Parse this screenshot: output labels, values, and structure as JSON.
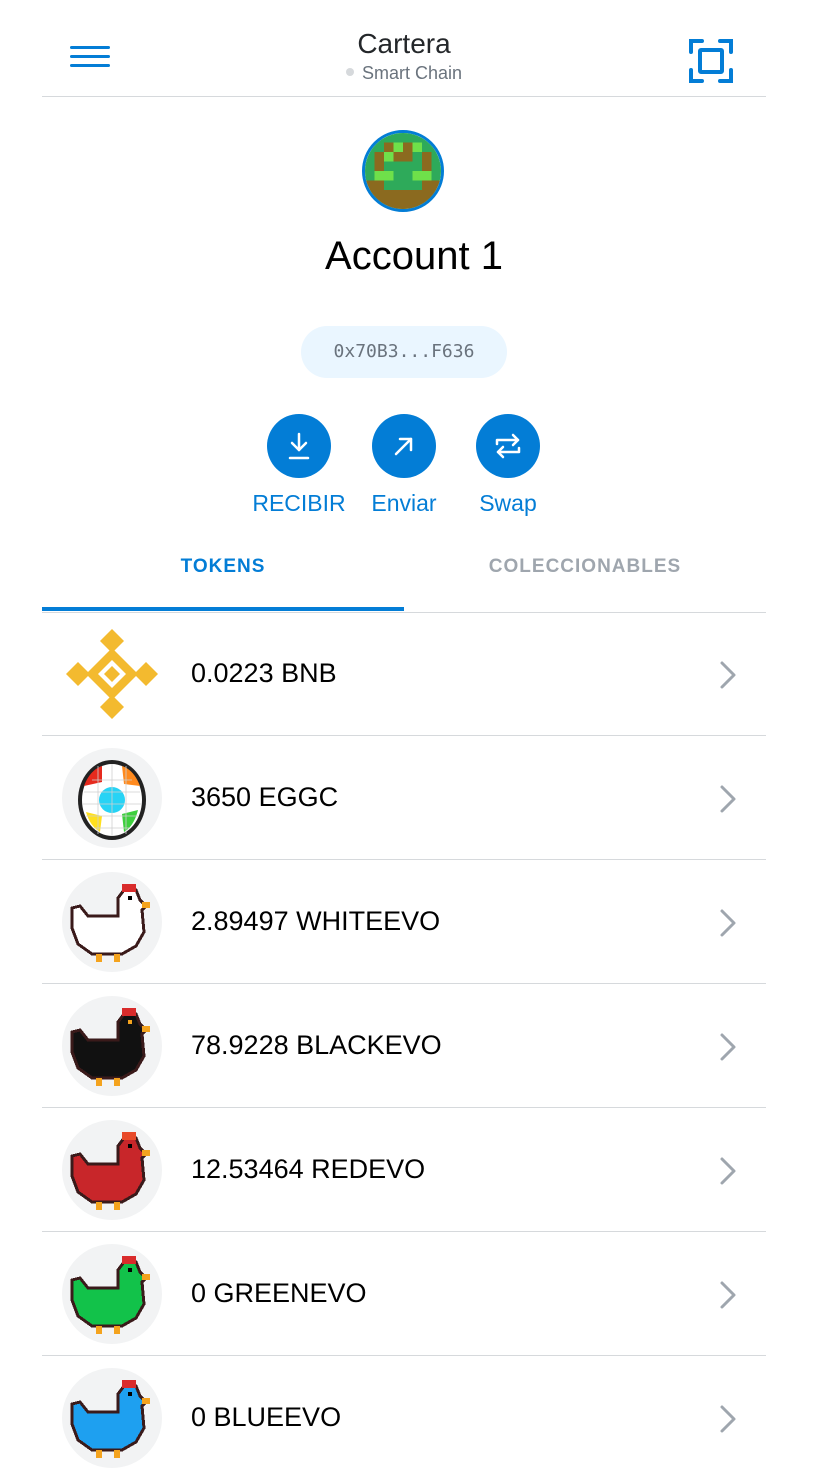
{
  "header": {
    "title": "Cartera",
    "network": "Smart Chain",
    "menu_icon": "hamburger-icon",
    "scan_icon": "qr-scan-icon",
    "accent_color": "#037dd6"
  },
  "account": {
    "name": "Account 1",
    "address": "0x70B3...F636"
  },
  "actions": [
    {
      "label": "RECIBIR",
      "icon": "download-icon"
    },
    {
      "label": "Enviar",
      "icon": "send-arrow-icon"
    },
    {
      "label": "Swap",
      "icon": "swap-icon"
    }
  ],
  "tabs": [
    {
      "label": "TOKENS",
      "active": true
    },
    {
      "label": "COLECCIONABLES",
      "active": false
    }
  ],
  "tokens": [
    {
      "label": "0.0223 BNB",
      "icon": "bnb-logo-icon"
    },
    {
      "label": "3650 EGGC",
      "icon": "egg-icon"
    },
    {
      "label": "2.89497 WHITEEVO",
      "icon": "white-chicken-icon"
    },
    {
      "label": "78.9228 BLACKEVO",
      "icon": "black-chicken-icon"
    },
    {
      "label": "12.53464 REDEVO",
      "icon": "red-chicken-icon"
    },
    {
      "label": "0 GREENEVO",
      "icon": "green-chicken-icon"
    },
    {
      "label": "0 BLUEEVO",
      "icon": "blue-chicken-icon"
    }
  ]
}
